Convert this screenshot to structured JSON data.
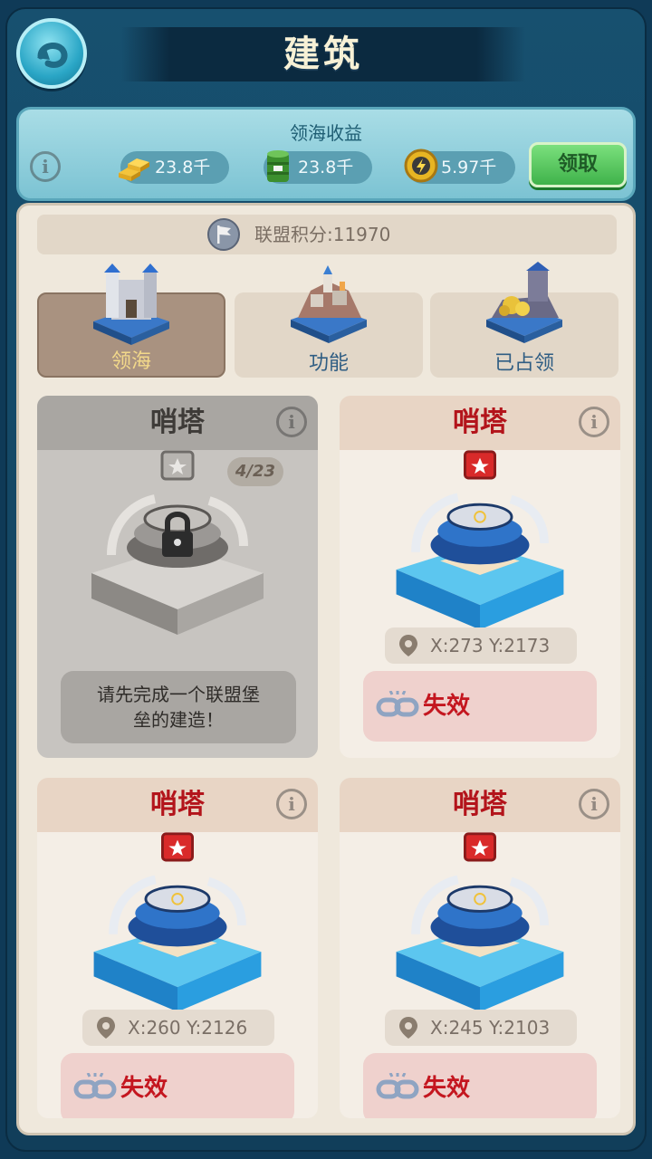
{
  "header": {
    "title": "建筑"
  },
  "income": {
    "title": "领海收益",
    "gold": "23.8千",
    "oil": "23.8千",
    "energy": "5.97千",
    "claim_label": "领取"
  },
  "alliance": {
    "score_label": "联盟积分:11970"
  },
  "tabs": [
    {
      "label": "领海",
      "active": true
    },
    {
      "label": "功能",
      "active": false
    },
    {
      "label": "已占领",
      "active": false
    }
  ],
  "cards": [
    {
      "title": "哨塔",
      "locked": true,
      "progress": "4/23",
      "message_line1": "请先完成一个联盟堡",
      "message_line2": "垒的建造！"
    },
    {
      "title": "哨塔",
      "locked": false,
      "coord": "X:273 Y:2173",
      "status": "失效"
    },
    {
      "title": "哨塔",
      "locked": false,
      "coord": "X:260 Y:2126",
      "status": "失效"
    },
    {
      "title": "哨塔",
      "locked": false,
      "coord": "X:245 Y:2103",
      "status": "失效"
    }
  ],
  "colors": {
    "accent_red": "#b3141b",
    "claim_green": "#3fb24a",
    "tab_active": "#a99280"
  }
}
